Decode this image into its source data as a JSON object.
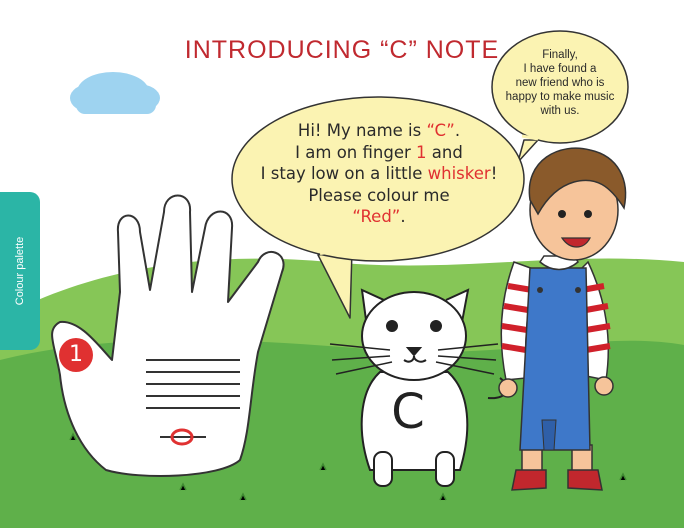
{
  "title": "INTRODUCING “C” NOTE",
  "palette_tab": {
    "label": "Colour palette"
  },
  "hand": {
    "finger_number": "1"
  },
  "cat": {
    "letter": "C"
  },
  "cat_speech": {
    "l1_a": "Hi! My name is ",
    "l1_b": "“C”",
    "l1_c": ".",
    "l2_a": "I am on finger ",
    "l2_b": "1",
    "l2_c": " and",
    "l3_a": "I stay low on a little ",
    "l3_b": "whisker",
    "l3_c": "!",
    "l4": "Please colour me",
    "l5": "“Red”",
    "l5_c": "."
  },
  "boy_speech": {
    "lines": [
      "Finally,",
      "I have found a",
      "new friend who is",
      "happy to make music",
      "with us."
    ]
  },
  "colors": {
    "accent_red": "#e03131",
    "title_red": "#c0292f",
    "palette_teal": "#2bb5a6",
    "grass": "#5fb04a",
    "sky_cloud": "#9ed3f0",
    "bubble": "#fbf3b2",
    "overalls": "#3e78c9"
  }
}
